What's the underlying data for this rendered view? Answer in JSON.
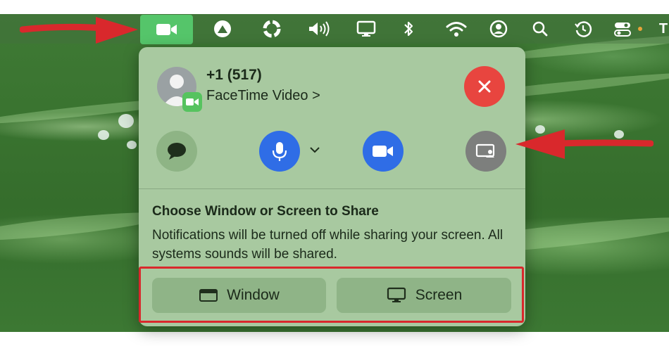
{
  "menubar": {
    "items": [
      {
        "icon": "facetime-video-icon",
        "active": true
      },
      {
        "icon": "airplay-icon"
      },
      {
        "icon": "sync-circle-icon"
      },
      {
        "icon": "volume-icon"
      },
      {
        "icon": "display-icon"
      },
      {
        "icon": "bluetooth-icon"
      },
      {
        "icon": "wifi-icon"
      },
      {
        "icon": "user-account-icon"
      },
      {
        "icon": "search-icon"
      },
      {
        "icon": "time-machine-icon"
      },
      {
        "icon": "control-center-icon"
      }
    ],
    "trailing_text": "T",
    "colors": {
      "active": "#55c56a",
      "indicator_dot": "#e8a33a"
    }
  },
  "call": {
    "number": "+1 (517)",
    "subtitle": "FaceTime Video >",
    "end_button_color": "#e8453f"
  },
  "controls": [
    {
      "name": "messages",
      "icon": "message-bubble-icon"
    },
    {
      "name": "microphone",
      "icon": "microphone-icon",
      "color": "#2f6de6",
      "has_dropdown": true
    },
    {
      "name": "video",
      "icon": "video-camera-icon",
      "color": "#2f6de6"
    },
    {
      "name": "screen-share",
      "icon": "screen-share-icon"
    }
  ],
  "share": {
    "title": "Choose Window or Screen to Share",
    "description": "Notifications will be turned off while sharing your screen. All systems sounds will be shared.",
    "window_label": "Window",
    "screen_label": "Screen"
  },
  "annotations": {
    "color": "#d9282c"
  }
}
